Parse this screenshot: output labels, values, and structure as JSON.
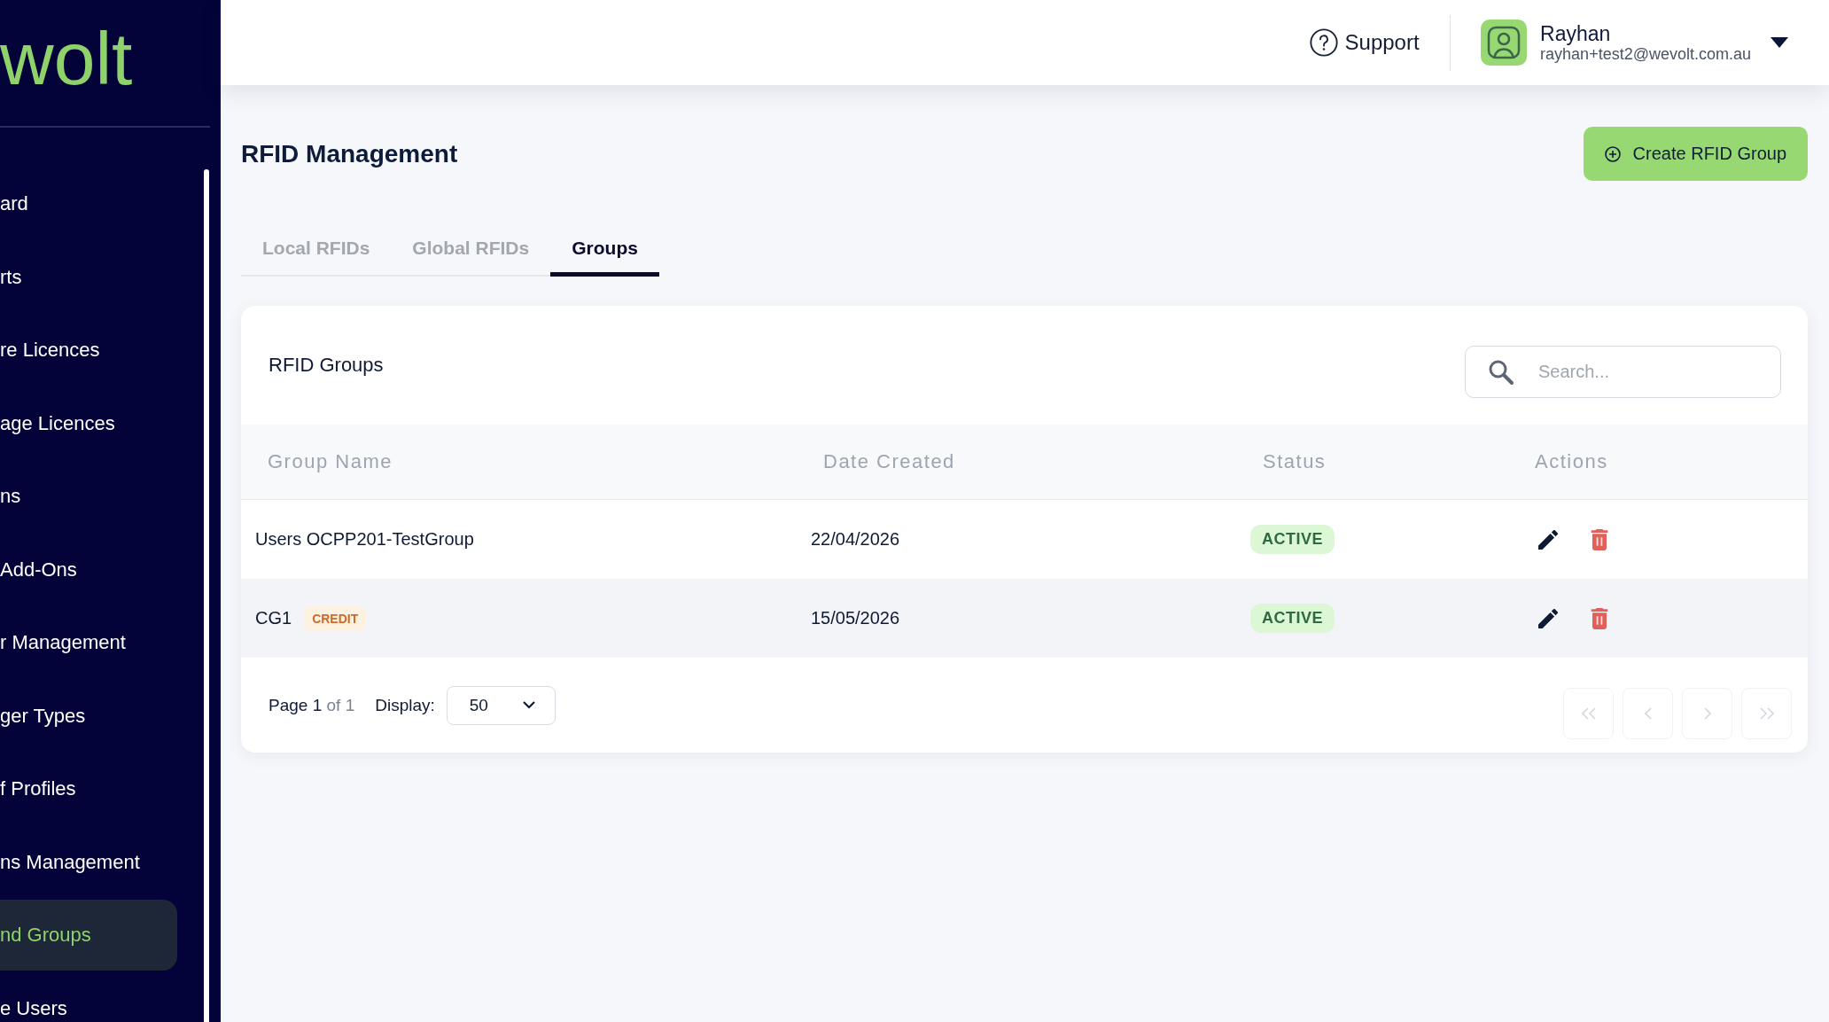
{
  "sidebar": {
    "logo": "wolt",
    "items": [
      {
        "label": "ard",
        "selected": false
      },
      {
        "label": "rts",
        "selected": false
      },
      {
        "label": "re Licences",
        "selected": false
      },
      {
        "label": "age Licences",
        "selected": false
      },
      {
        "label": "ns",
        "selected": false
      },
      {
        "label": "Add-Ons",
        "selected": false
      },
      {
        "label": "r Management",
        "selected": false
      },
      {
        "label": "ger Types",
        "selected": false
      },
      {
        "label": "f Profiles",
        "selected": false
      },
      {
        "label": "ns Management",
        "selected": false
      },
      {
        "label": "nd Groups",
        "selected": true
      },
      {
        "label": "e Users",
        "selected": false
      }
    ]
  },
  "header": {
    "support": "Support",
    "user": {
      "name": "Rayhan",
      "email": "rayhan+test2@wevolt.com.au"
    }
  },
  "page": {
    "title": "RFID Management",
    "create_button": "Create RFID Group"
  },
  "tabs": [
    {
      "label": "Local RFIDs",
      "selected": false
    },
    {
      "label": "Global RFIDs",
      "selected": false
    },
    {
      "label": "Groups",
      "selected": true
    }
  ],
  "card": {
    "title": "RFID Groups",
    "search": {
      "placeholder": "Search..."
    },
    "table": {
      "columns": [
        "Group Name",
        "Date Created",
        "Status",
        "Actions"
      ],
      "rows": [
        {
          "name": "Users OCPP201-TestGroup",
          "date": "22/04/2026",
          "status": "ACTIVE"
        },
        {
          "name": "CG1",
          "tag": "CREDIT",
          "date": "15/05/2026",
          "status": "ACTIVE"
        }
      ]
    },
    "footer": {
      "page_label": "Page 1",
      "page_of": "of 1",
      "display_label": "Display:",
      "page_size": "50",
      "pager": [
        {
          "kind": "first",
          "disabled": true
        },
        {
          "kind": "prev",
          "disabled": true
        },
        {
          "kind": "next",
          "disabled": true
        },
        {
          "kind": "last",
          "disabled": true
        }
      ]
    }
  }
}
